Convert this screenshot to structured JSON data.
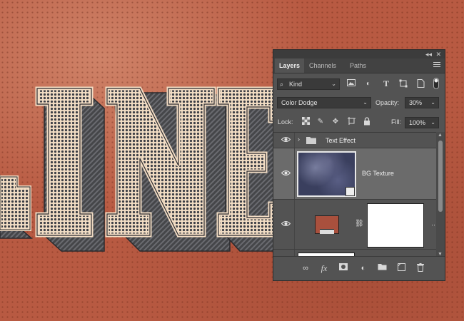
{
  "artwork": {
    "visible_text": "LINE"
  },
  "layers_panel": {
    "collapse_glyph": "◂◂",
    "close_glyph": "✕",
    "tabs": [
      {
        "label": "Layers",
        "active": true
      },
      {
        "label": "Channels",
        "active": false
      },
      {
        "label": "Paths",
        "active": false
      }
    ],
    "filter": {
      "value": "Kind"
    },
    "blend_mode": {
      "value": "Color Dodge"
    },
    "opacity": {
      "label": "Opacity:",
      "value": "30%"
    },
    "lock": {
      "label": "Lock:"
    },
    "fill": {
      "label": "Fill:",
      "value": "100%"
    },
    "layers": [
      {
        "name": "Text Effect",
        "type": "group",
        "visible": true
      },
      {
        "name": "BG Texture",
        "type": "smart-object",
        "visible": true,
        "selected": true
      },
      {
        "name": "",
        "type": "adjustment-with-mask",
        "visible": true,
        "swatch_color": "#a9503d"
      },
      {
        "name": "",
        "type": "layer",
        "visible": false
      }
    ]
  },
  "icons": [
    "eye-icon",
    "folder-icon",
    "chevron-right-icon",
    "link-icon",
    "fx-icon",
    "mask-icon",
    "adjustment-icon",
    "new-group-icon",
    "new-layer-icon",
    "trash-icon",
    "image-filter-icon",
    "adjustment-filter-icon",
    "type-filter-icon",
    "shape-filter-icon",
    "smart-object-filter-icon",
    "filter-toggle-icon",
    "lock-transparent-icon",
    "lock-image-icon",
    "lock-position-icon",
    "lock-artboard-icon",
    "lock-all-icon"
  ],
  "colors": {
    "background": "#b85a42",
    "panel": "#535353",
    "panel_dark": "#3a3a3a",
    "selected_layer": "#6b6b6b",
    "letter_outline": "#f2dcc4",
    "letter_extrude": "#4a4b50"
  }
}
